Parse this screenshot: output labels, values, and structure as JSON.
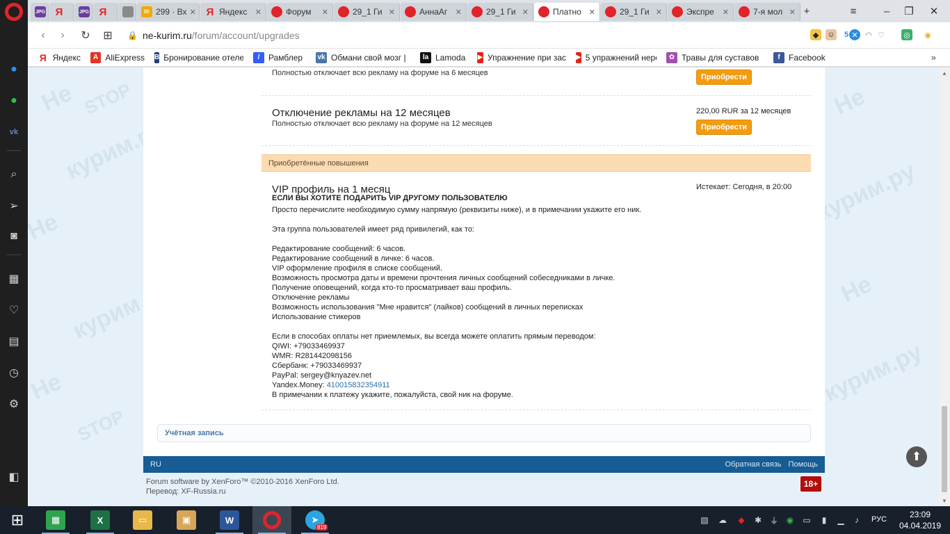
{
  "tabs": [
    {
      "label": "",
      "icon": "jpg-icon",
      "fav": "JPG"
    },
    {
      "label": "",
      "icon": "yandex-icon",
      "fav": "Я"
    },
    {
      "label": "",
      "icon": "jpg-icon",
      "fav": "JPG"
    },
    {
      "label": "",
      "icon": "yandex-icon",
      "fav": "Я"
    },
    {
      "label": "",
      "icon": "document-icon",
      "fav": ""
    },
    {
      "label": "299 · Вх",
      "icon": "mail-icon",
      "fav": "✉"
    },
    {
      "label": "Яндекс",
      "icon": "yandex-icon",
      "fav": "Я"
    },
    {
      "label": "Форум",
      "icon": "stop-icon",
      "fav": ""
    },
    {
      "label": "29_1 Ги",
      "icon": "stop-icon",
      "fav": ""
    },
    {
      "label": "АннаАг",
      "icon": "stop-icon",
      "fav": ""
    },
    {
      "label": "29_1 Ги",
      "icon": "stop-icon",
      "fav": ""
    },
    {
      "label": "Платно",
      "icon": "stop-icon",
      "fav": "",
      "active": true
    },
    {
      "label": "29_1 Ги",
      "icon": "stop-icon",
      "fav": ""
    },
    {
      "label": "Экспре",
      "icon": "stop-icon",
      "fav": ""
    },
    {
      "label": "7-я мол",
      "icon": "stop-icon",
      "fav": ""
    }
  ],
  "address": {
    "domain": "ne-kurim.ru",
    "path": "/forum/account/upgrades",
    "badge_count": "5"
  },
  "bookmarks": [
    {
      "label": "Яндекс",
      "icon": "yandex-icon",
      "glyph": "Я",
      "color": "#e52620"
    },
    {
      "label": "AliExpress",
      "icon": "aliexpress-icon",
      "glyph": "A",
      "color": "#e43225"
    },
    {
      "label": "Бронирование отеле",
      "icon": "booking-icon",
      "glyph": "B",
      "color": "#1f3e7d"
    },
    {
      "label": "Рамблер",
      "icon": "rambler-icon",
      "glyph": "/",
      "color": "#315efb"
    },
    {
      "label": "Обмани свой мозг |",
      "icon": "vk-icon",
      "glyph": "vk",
      "color": "#4a76a8"
    },
    {
      "label": "Lamoda",
      "icon": "lamoda-icon",
      "glyph": "la",
      "color": "#111111"
    },
    {
      "label": "Упражнение при зас",
      "icon": "youtube-icon",
      "glyph": "▶",
      "color": "#e62117"
    },
    {
      "label": "5 упражнений нере",
      "icon": "youtube-icon",
      "glyph": "▶",
      "color": "#e62117"
    },
    {
      "label": "Травы для суставов",
      "icon": "herb-icon",
      "glyph": "✿",
      "color": "#a24fb0"
    },
    {
      "label": "Facebook",
      "icon": "facebook-icon",
      "glyph": "f",
      "color": "#3b5998"
    }
  ],
  "upgrades": [
    {
      "title": "",
      "description": "Полностью отключает всю рекламу на форуме на 6 месяцев",
      "price": "",
      "button": "Приобрести"
    },
    {
      "title": "Отключение рекламы на 12 месяцев",
      "description": "Полностью отключает всю рекламу на форуме на 12 месяцев",
      "price": "220,00 RUR за 12 месяцев",
      "button": "Приобрести"
    }
  ],
  "purchased_header": "Приобретённые повышения",
  "vip": {
    "title": "VIP профиль на 1 месяц",
    "subtitle": "ЕСЛИ ВЫ ХОТИТЕ ПОДАРИТЬ VIP ДРУГОМУ ПОЛЬЗОВАТЕЛЮ",
    "expires": "Истекает: Сегодня, в 20:00",
    "lines": [
      "Просто перечислите необходимую сумму напрямую (реквизиты ниже), и в примечании укажите его ник.",
      "",
      "Эта группа пользователей имеет ряд привилегий, как то:",
      "",
      "Редактирование сообщений: 6 часов.",
      "Редактирование сообщений в личке: 6 часов.",
      "VIP оформление профиля в списке сообщений.",
      "Возможность просмотра даты и времени прочтения личных сообщений собеседниками в личке.",
      "Получение оповещений, когда кто-то просматривает ваш профиль.",
      "Отключение рекламы",
      "Возможность использования \"Мне нравится\" (лайков) сообщений в личных переписках",
      "Использование стикеров",
      "",
      "Если в способах оплаты нет приемлемых, вы всегда можете оплатить прямым переводом:",
      "QIWI: +79033469937",
      "WMR: R281442098156",
      "Сбербанк: +79033469937",
      "PayPal: sergey@knyazev.net"
    ],
    "yandex_label": "Yandex.Money: ",
    "yandex_value": "410015832354911",
    "last_line": "В примечании к платежу укажите, пожалуйста, свой ник на форуме."
  },
  "account_label": "Учётная запись",
  "footer": {
    "lang": "RU",
    "feedback": "Обратная связь",
    "help": "Помощь",
    "copyright1": "Forum software by XenForo™ ©2010-2016 XenForo Ltd.",
    "copyright2": "Перевод: XF-Russia.ru",
    "age_badge": "18+"
  },
  "watermark": [
    "Не",
    "STOP",
    "курим.ру"
  ],
  "taskbar": {
    "time": "23:09",
    "date": "04.04.2019",
    "lang": "РУС",
    "telegram_badge": "819"
  }
}
